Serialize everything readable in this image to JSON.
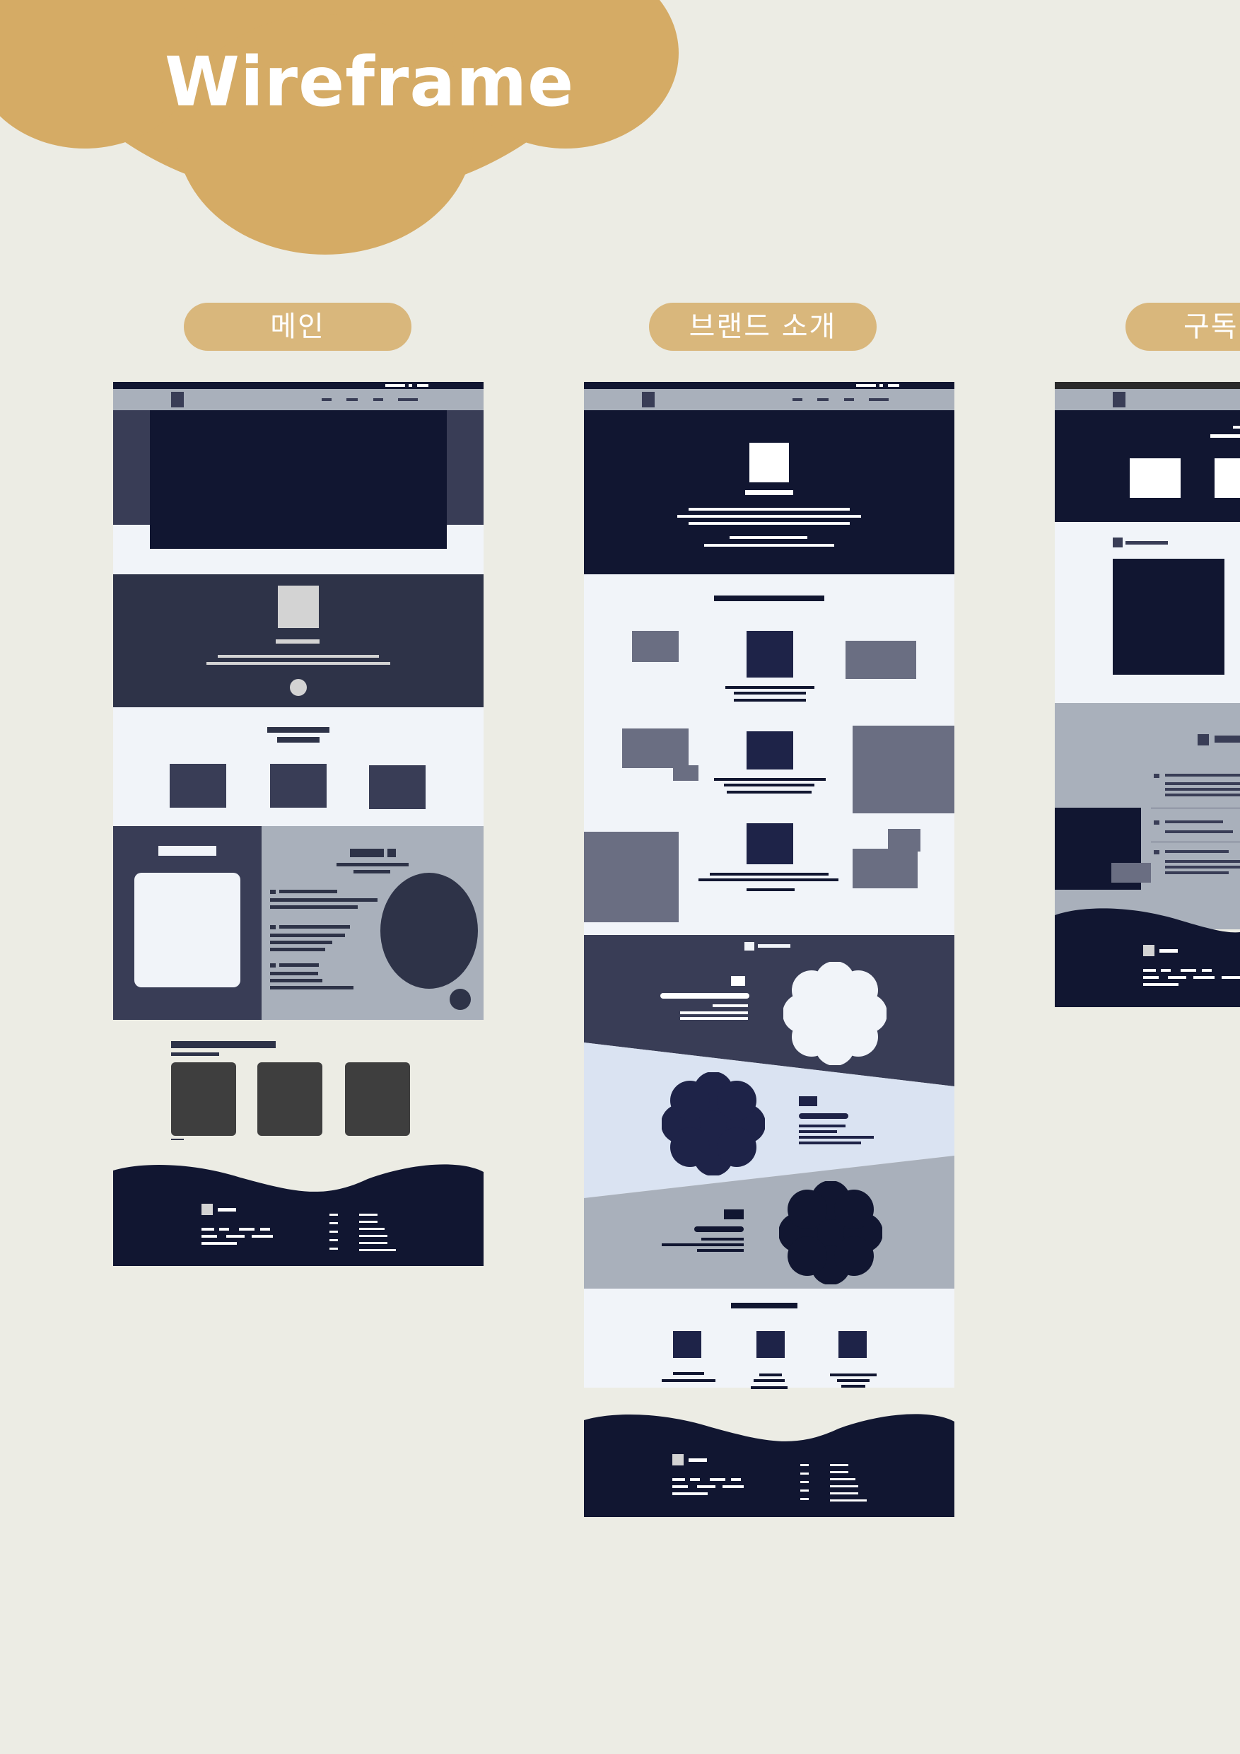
{
  "header": {
    "title": "Wireframe"
  },
  "pages": [
    {
      "label": "메인"
    },
    {
      "label": "브랜드 소개"
    },
    {
      "label": "구독"
    }
  ],
  "colors": {
    "background": "#ecece4",
    "accent": "#d5ab65",
    "tab": "#d9b77c",
    "navy": "#111631",
    "slate": "#2e3348",
    "grey": "#a9b0bb",
    "light": "#f1f4f9"
  }
}
